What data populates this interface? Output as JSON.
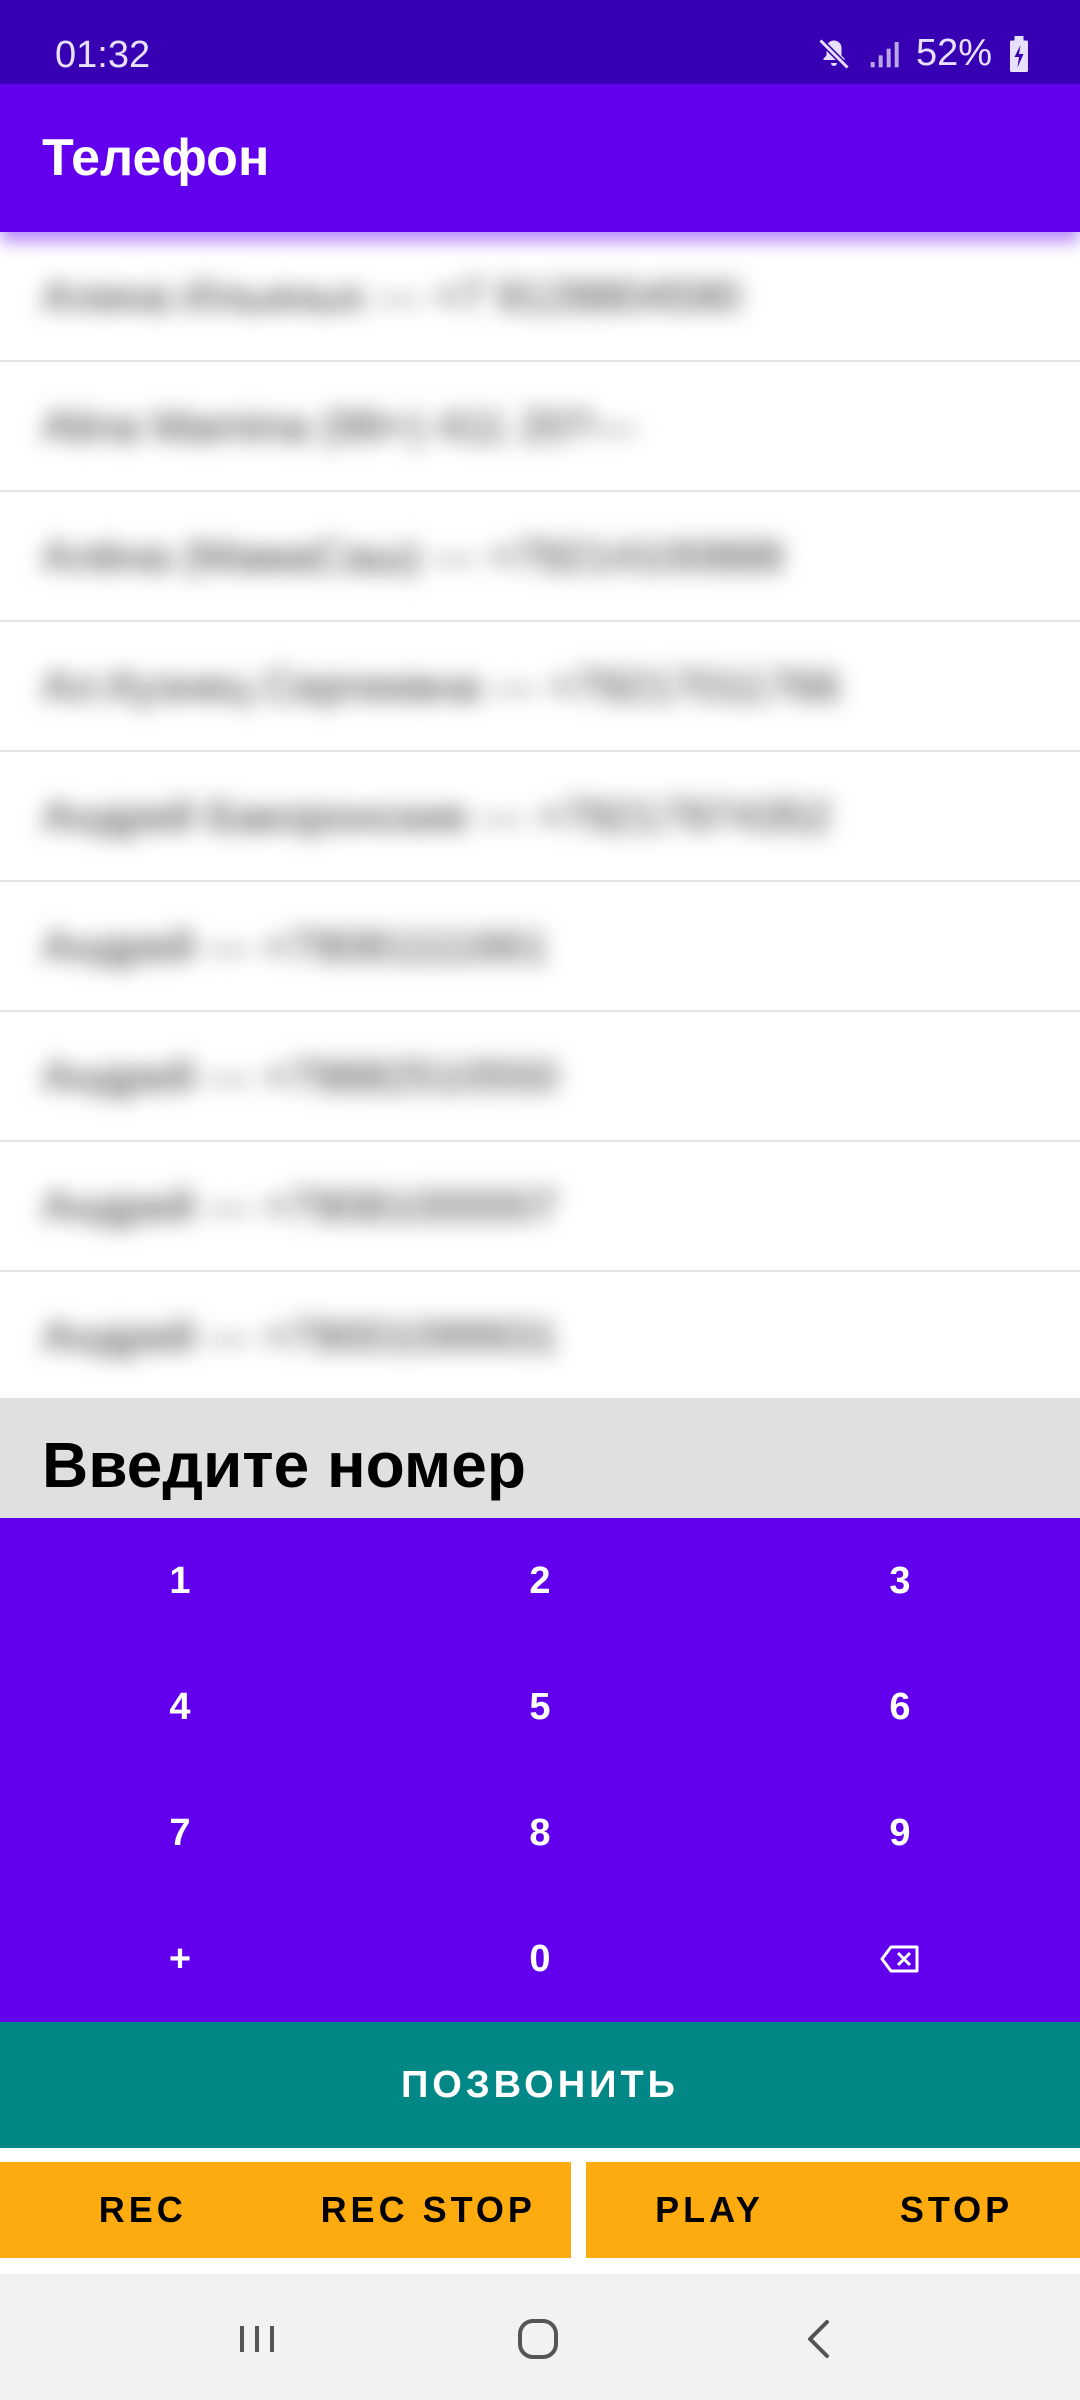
{
  "status_bar": {
    "time": "01:32",
    "battery": "52%",
    "icons": [
      "mute-icon",
      "signal-icon",
      "battery-charging-icon"
    ]
  },
  "app_bar": {
    "title": "Телефон"
  },
  "contacts": [
    {
      "text": "Алина Ильиных — +7 9128804590"
    },
    {
      "text": "Alina Mamina (99+) 411 20?—"
    },
    {
      "text": "Алёна (МамаСаш) — +79214100888"
    },
    {
      "text": "Ал.Кузнец Сергеевна — +79217011766"
    },
    {
      "text": "Андрей Бакоронские — +79217974352"
    },
    {
      "text": "Андрей — +79081111661"
    },
    {
      "text": "Андрей — +79882510550"
    },
    {
      "text": "Андрей — +79081000007"
    },
    {
      "text": "Андрей — +79001099931"
    }
  ],
  "number_field": {
    "placeholder": "Введите номер"
  },
  "keypad": {
    "keys": [
      "1",
      "2",
      "3",
      "4",
      "5",
      "6",
      "7",
      "8",
      "9",
      "+",
      "0",
      "⌫"
    ]
  },
  "call_button": {
    "label": "ПОЗВОНИТЬ"
  },
  "audio_buttons": {
    "rec": "REC",
    "rec_stop": "REC STOP",
    "play": "PLAY",
    "stop": "STOP"
  },
  "colors": {
    "status_bar": "#3700b3",
    "primary": "#6200ee",
    "call_button": "#018786",
    "audio_buttons": "#fdab0f",
    "number_field_bg": "#e0e0e0"
  }
}
